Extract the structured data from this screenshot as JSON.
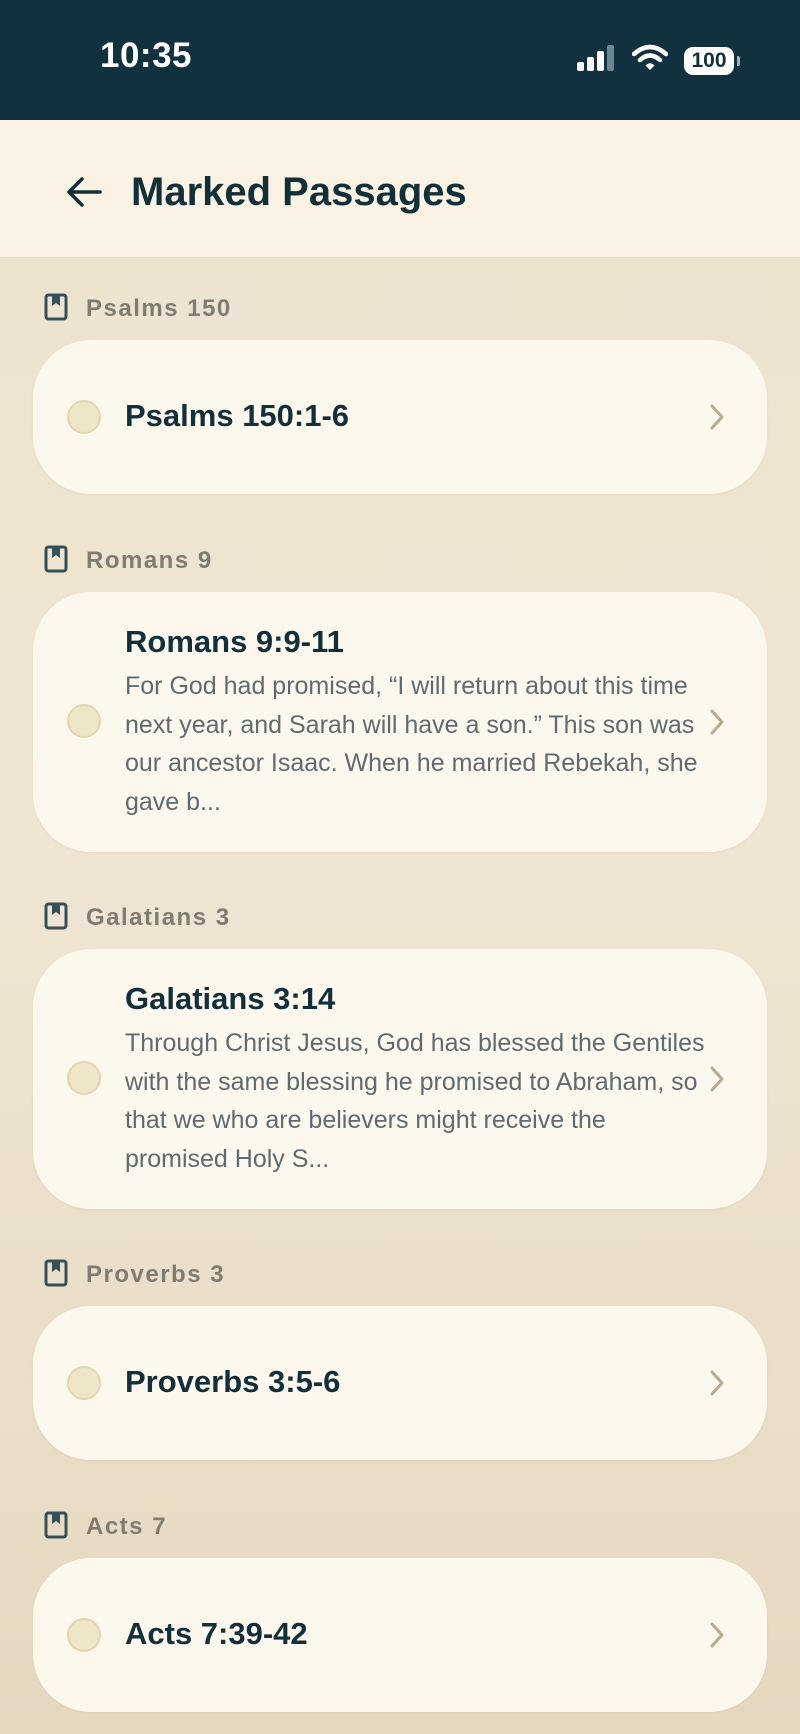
{
  "status_bar": {
    "time": "10:35",
    "battery": "100"
  },
  "header": {
    "title": "Marked Passages"
  },
  "colors": {
    "status_bar_bg": "#10313d",
    "header_bg": "#faf3e4",
    "card_bg": "#fcf8ee",
    "title_text": "#12303a",
    "section_label": "#7d7d74",
    "excerpt_text": "#5f6b70"
  },
  "sections": [
    {
      "label": "Psalms 150",
      "icon": "bookmark-book-icon",
      "passage": {
        "reference": "Psalms 150:1-6",
        "excerpt": ""
      }
    },
    {
      "label": "Romans 9",
      "icon": "bookmark-book-icon",
      "passage": {
        "reference": "Romans 9:9-11",
        "excerpt": "For God had promised, “I will return about this time next year, and Sarah will have a son.” This son was our ancestor Isaac. When he married Rebekah, she gave b..."
      }
    },
    {
      "label": "Galatians 3",
      "icon": "bookmark-book-icon",
      "passage": {
        "reference": "Galatians 3:14",
        "excerpt": "Through Christ Jesus, God has blessed the Gentiles with the same blessing he promised to Abraham, so that we who are believers might receive the promised Holy S..."
      }
    },
    {
      "label": "Proverbs 3",
      "icon": "bookmark-book-icon",
      "passage": {
        "reference": "Proverbs 3:5-6",
        "excerpt": ""
      }
    },
    {
      "label": "Acts 7",
      "icon": "bookmark-book-icon",
      "passage": {
        "reference": "Acts 7:39-42",
        "excerpt": ""
      }
    }
  ]
}
